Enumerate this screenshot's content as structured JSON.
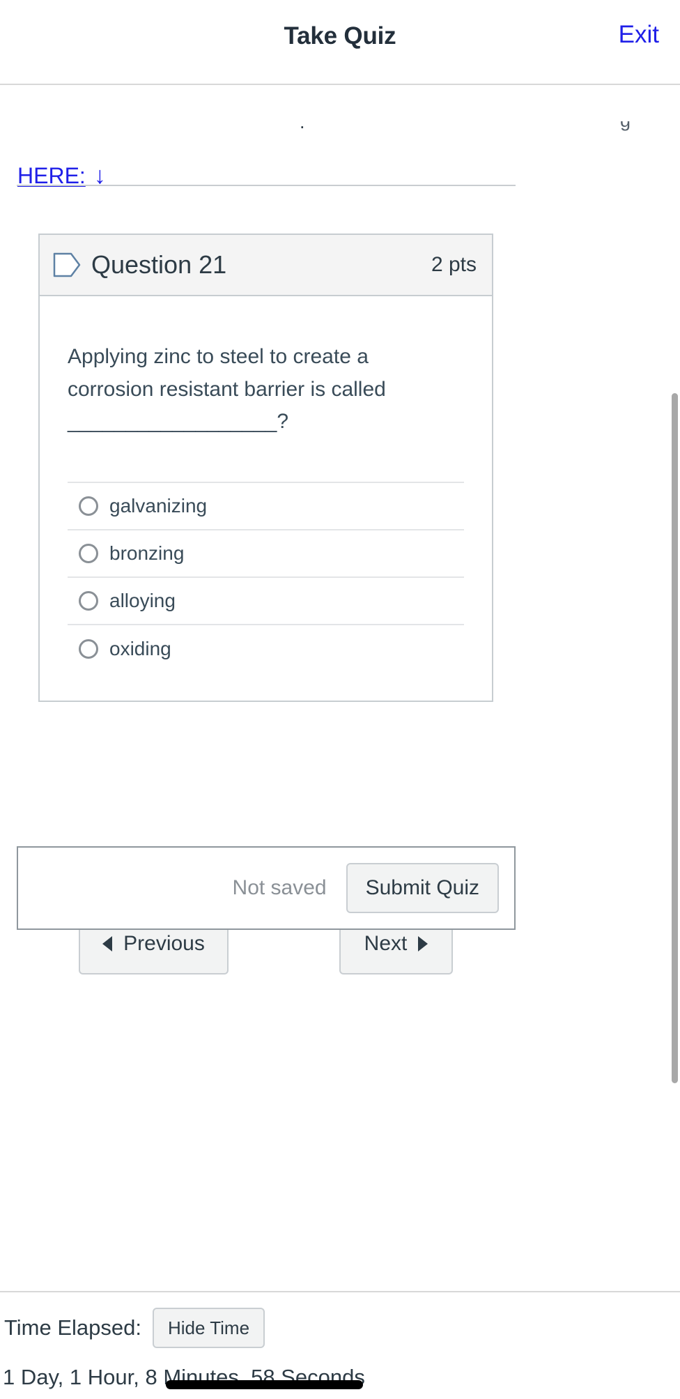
{
  "appbar": {
    "title": "Take Quiz",
    "exit_label": "Exit"
  },
  "content": {
    "clipped_fragment_left": ".",
    "clipped_fragment_right": "g",
    "here_link_label": "HERE:",
    "here_arrow_glyph": "↓"
  },
  "question": {
    "flag_icon": "flag-outline-icon",
    "title": "Question 21",
    "points": "2 pts",
    "text": "Applying zinc to steel to create a corrosion resistant barrier is called __________________?",
    "answers": [
      {
        "label": "galvanizing",
        "selected": false
      },
      {
        "label": "bronzing",
        "selected": false
      },
      {
        "label": "alloying",
        "selected": false
      },
      {
        "label": "oxiding",
        "selected": false
      }
    ]
  },
  "navigation": {
    "previous_label": "Previous",
    "next_label": "Next",
    "previous_icon": "triangle-left-icon",
    "next_icon": "triangle-right-icon"
  },
  "submit": {
    "status_label": "Not saved",
    "submit_label": "Submit Quiz"
  },
  "timer": {
    "elapsed_label": "Time Elapsed:",
    "hide_time_label": "Hide Time",
    "elapsed_value": "1 Day, 1 Hour, 8 Minutes, 58 Seconds"
  },
  "colors": {
    "link_blue": "#1f1fe8",
    "text_dark": "#2d3b45",
    "text_muted": "#8a9096",
    "border": "#c9ced2",
    "button_bg": "#f2f3f3",
    "header_bg": "#f4f4f4"
  }
}
